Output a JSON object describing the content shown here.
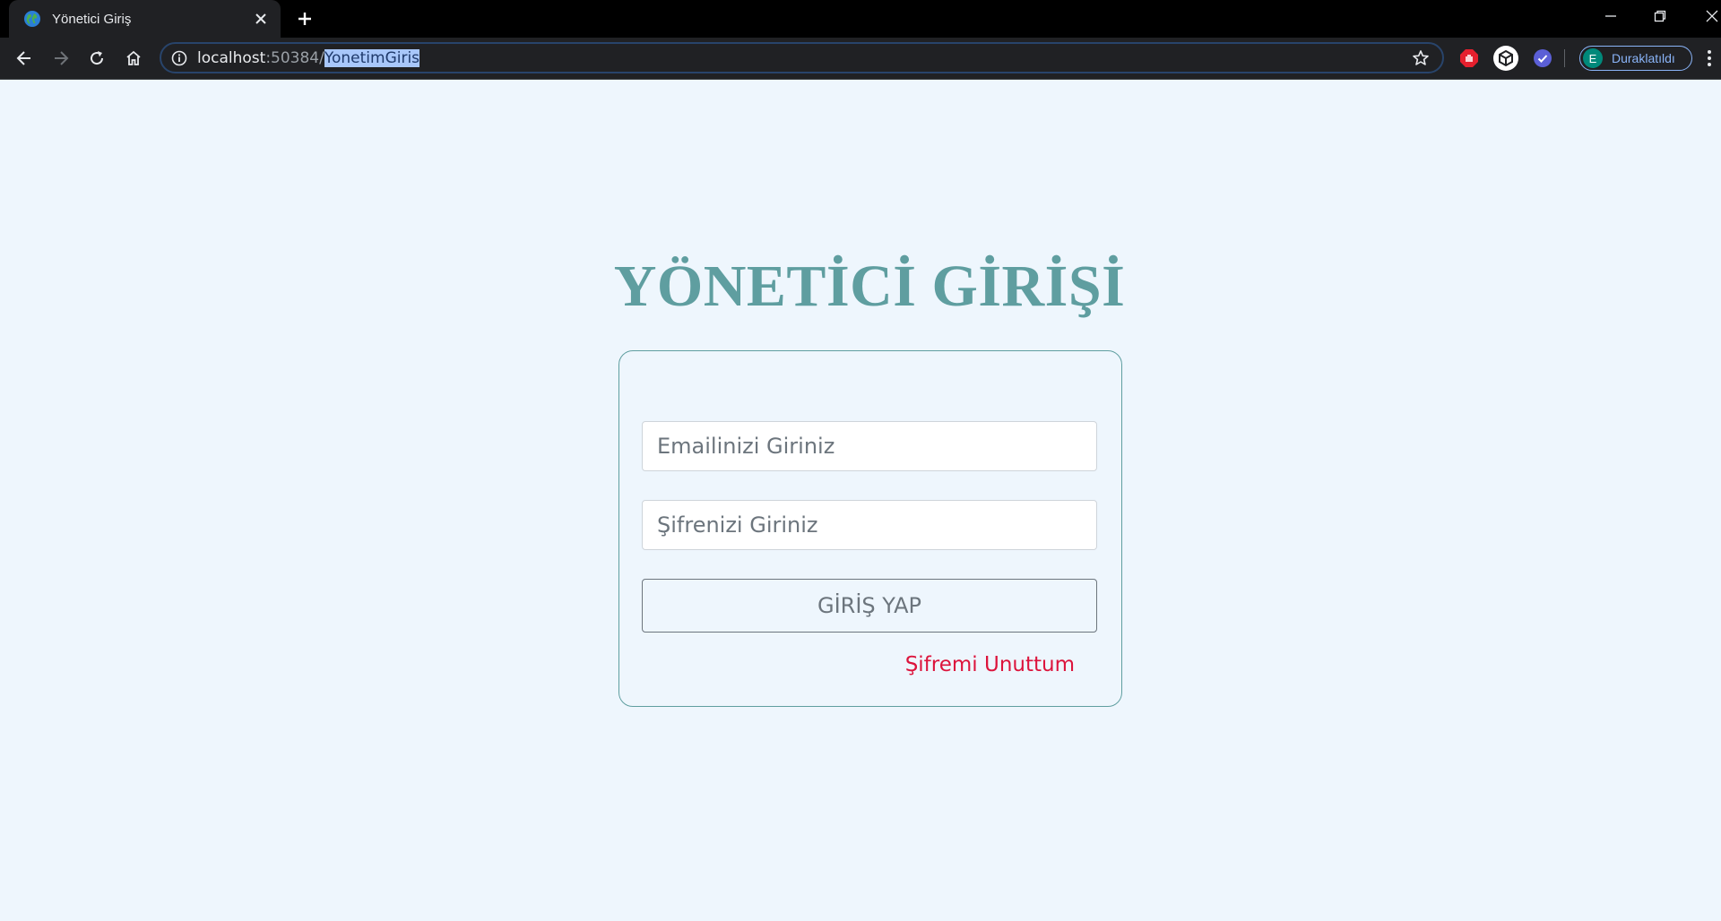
{
  "browser": {
    "tab_title": "Yönetici Giriş",
    "url_host": "localhost",
    "url_port": ":50384/",
    "url_path": "YonetimGiris",
    "profile_initial": "E",
    "profile_label": "Duraklatıldı"
  },
  "page": {
    "title": "YÖNETİCİ GİRİŞİ",
    "email_placeholder": "Emailinizi Giriniz",
    "password_placeholder": "Şifrenizi Giriniz",
    "login_button": "GİRİŞ YAP",
    "forgot_link": "Şifremi Unuttum"
  },
  "colors": {
    "title": "#5f9ea0",
    "forgot_link": "#dc143c",
    "background": "#eef6fd"
  },
  "icons": [
    "globe-icon",
    "close-icon",
    "plus-icon",
    "minimize-icon",
    "restore-icon",
    "window-close-icon",
    "back-icon",
    "forward-icon",
    "reload-icon",
    "home-icon",
    "info-icon",
    "star-icon",
    "adblock-icon",
    "cube-extension-icon",
    "check-extension-icon",
    "menu-dots-icon"
  ]
}
